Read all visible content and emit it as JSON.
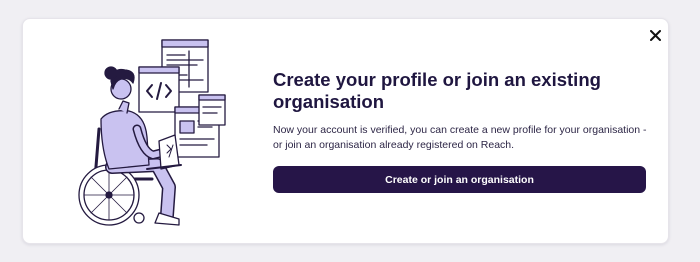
{
  "modal": {
    "title": "Create your profile or join an existing organisation",
    "description": "Now your account is verified, you can create a new profile for your organisation - or join an organisation already registered on Reach.",
    "cta_label": "Create or join an organisation",
    "close_icon": "close-icon",
    "illustration": "person-in-wheelchair-with-laptop-and-web-pages"
  },
  "colors": {
    "page_background": "#f0eff3",
    "card_background": "#ffffff",
    "primary": "#261548",
    "title_text": "#1f1640",
    "illustration_accent": "#c9c2f0"
  }
}
